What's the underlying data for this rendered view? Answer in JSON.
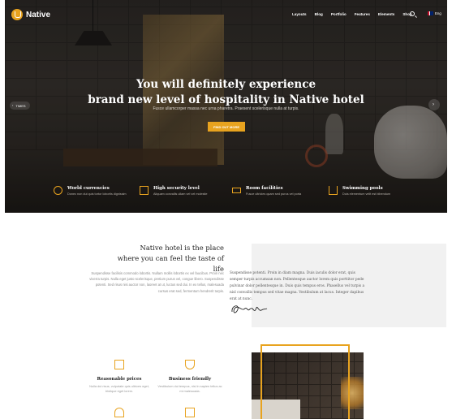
{
  "brand": {
    "name": "Native",
    "accent": "#e8a31f"
  },
  "nav": {
    "items": [
      "Layouts",
      "Blog",
      "Portfolio",
      "Features",
      "Elements",
      "Shop"
    ],
    "lang": "Eng"
  },
  "hero": {
    "title_line1": "You will definitely experience",
    "title_line2": "brand new level of hospitality in Native hotel",
    "subtitle": "Fusce ullamcorper massa nec urna pharetra. Praesent scelerisque nulla at turpis.",
    "cta": "FIND OUT MORE",
    "prev_label": "TIMES"
  },
  "features": [
    {
      "icon": "globe-icon",
      "title": "World currencies",
      "desc": "Donec non dui quis tortor lobortis dignissim"
    },
    {
      "icon": "safe-icon",
      "title": "High security level",
      "desc": "Aliquam convallis ullam vel vel molestie"
    },
    {
      "icon": "air-conditioner-icon",
      "title": "Room facilities",
      "desc": "Fusce ultricies quam sed purus vel porta"
    },
    {
      "icon": "pool-ladder-icon",
      "title": "Swimming pools",
      "desc": "Duis elementum velit est bibendum"
    }
  ],
  "about": {
    "title_line1": "Native hotel is the place",
    "title_line2": "where you can feel the taste of life",
    "left_text": "Suspendisse facilisis commodo lobortis. Nullam mollis lobortis ex vel faucibus. Proin nec viverra turpis. Nulla eget justo scelerisque, pretium purus vel, congue libero. Suspendisse potenti. Sed risus nisi auctor non, laoreet at ut, luctus sed dui. In ex tellus, malesuada cursus erat sed, fermentum hendrerit turpis.",
    "right_text": "Suspendisse potenti. Proin in diam magna. Duis iaculis dolor erat, quis semper turpis accumsan non. Pellentesque auctor lorem quis porttitor pede pulvinar dolor pellentesque in. Duis quis tempus eros. Phasellus vel turpis a nisl convallis tempus sed vitae magna. Vestibulum at lacus. Integer dapibus erat at nunc."
  },
  "services": [
    {
      "icon": "wallet-icon",
      "title": "Reasonable prices",
      "desc": "Nulla dui risus, vulputate quis ultrices eget, tristique eget lorem."
    },
    {
      "icon": "shield-check-icon",
      "title": "Business friendly",
      "desc": "Vestibulum dui tempus, nisl in sapien tellus ac mi malesuada."
    },
    {
      "icon": "iron-icon",
      "title": "",
      "desc": ""
    },
    {
      "icon": "towel-icon",
      "title": "",
      "desc": ""
    }
  ]
}
